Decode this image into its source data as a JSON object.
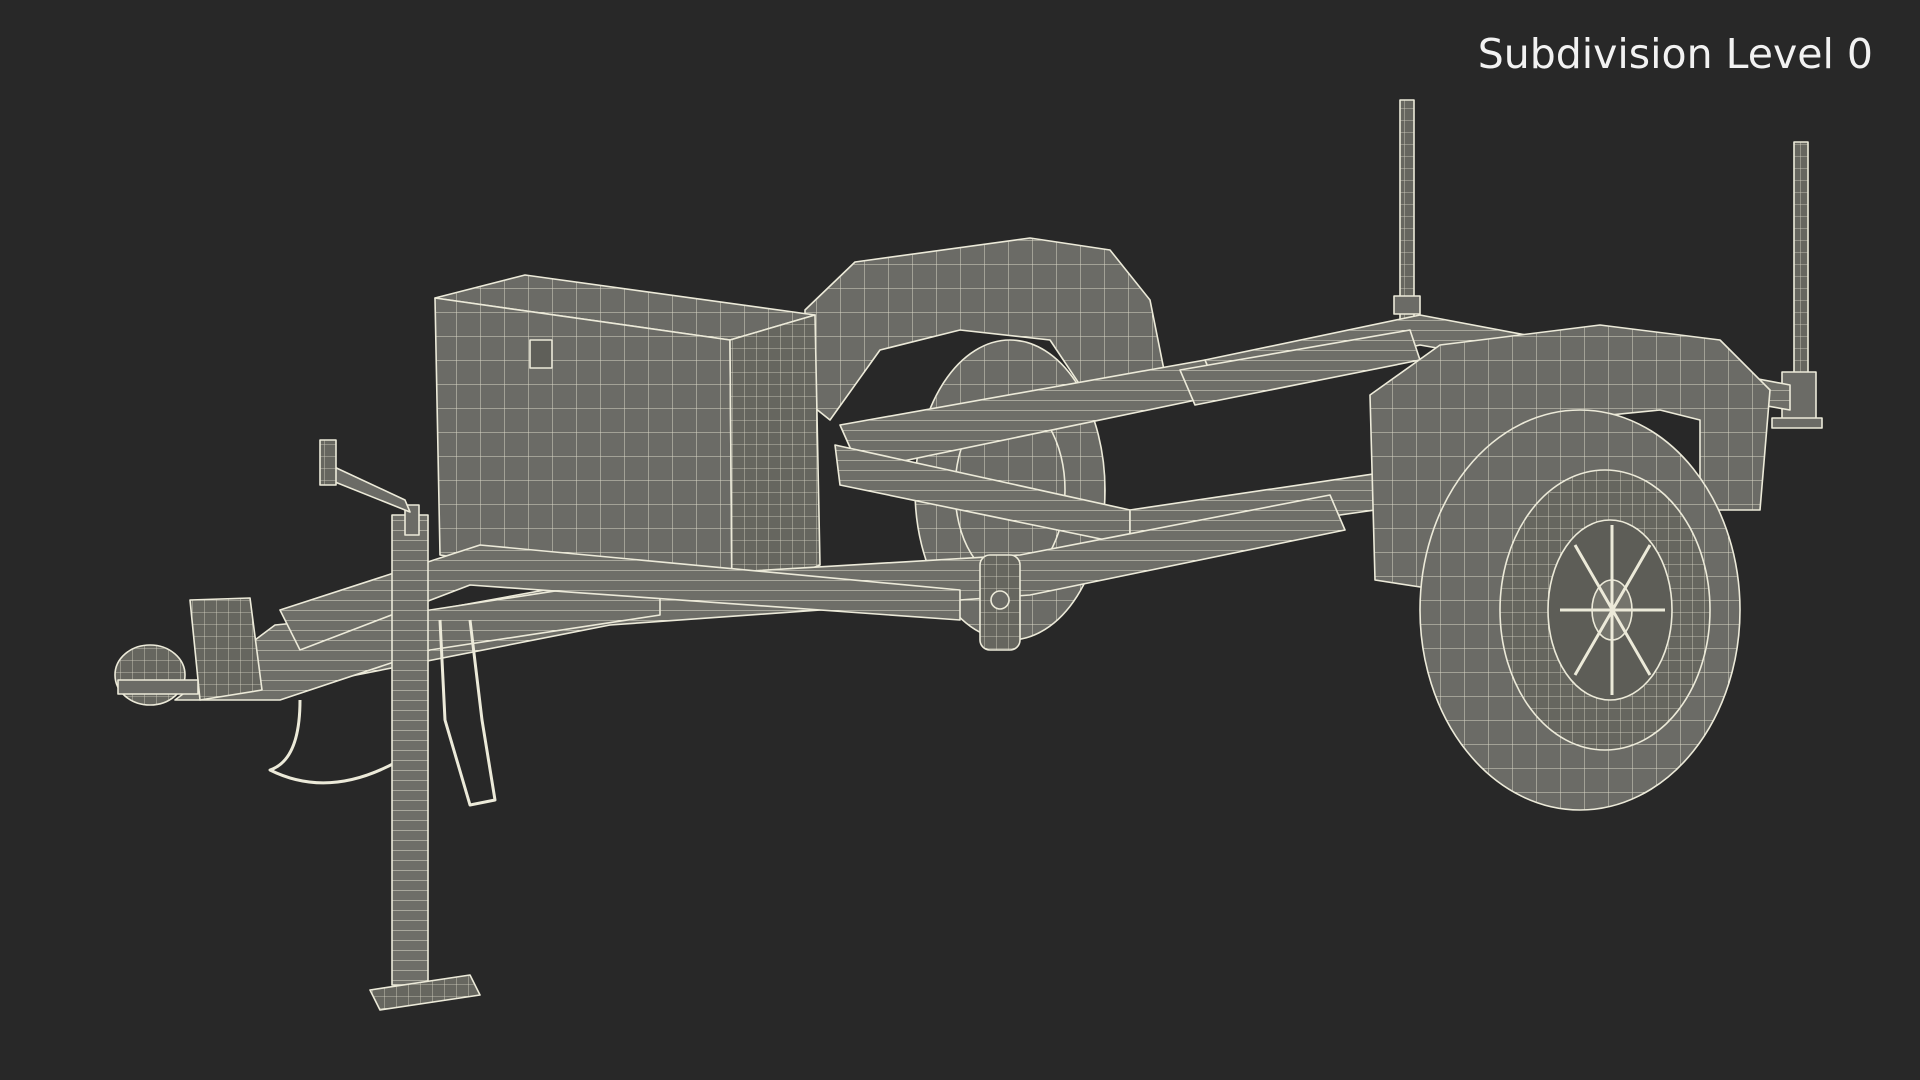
{
  "viewport": {
    "overlay_label": "Subdivision Level 0",
    "background_color": "#282828",
    "mesh_fill_color": "#6b6b66",
    "wire_color": "#e8e6d6",
    "subject": "trailer-wireframe-model"
  }
}
